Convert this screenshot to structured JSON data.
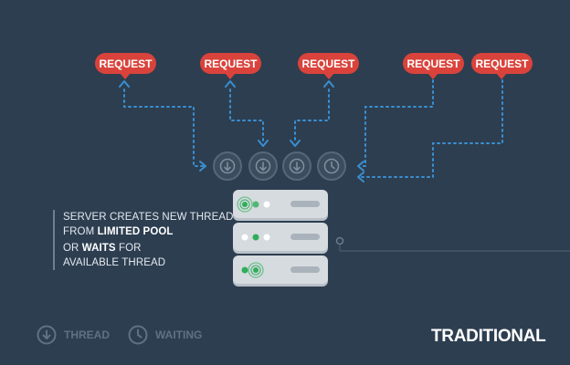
{
  "requests": [
    "REQUEST",
    "REQUEST",
    "REQUEST",
    "REQUEST",
    "REQUEST"
  ],
  "caption": {
    "line1": "SERVER CREATES NEW THREAD",
    "line2_prefix": "FROM ",
    "line2_bold": "LIMITED POOL",
    "line3_prefix": "OR ",
    "line3_bold": "WAITS",
    "line3_suffix": " FOR",
    "line4": "AVAILABLE THREAD"
  },
  "legend": {
    "thread_label": "THREAD",
    "waiting_label": "WAITING",
    "thread_icon": "down-arrow-circle-icon",
    "waiting_icon": "clock-icon"
  },
  "brand_label": "TRADITIONAL",
  "colors": {
    "background": "#2d3e50",
    "request_red": "#d9433b",
    "connector_blue": "#3a8fd1",
    "slot_gray": "#566878",
    "server_gray": "#d6dbdf",
    "led_green": "#2fae5a"
  }
}
